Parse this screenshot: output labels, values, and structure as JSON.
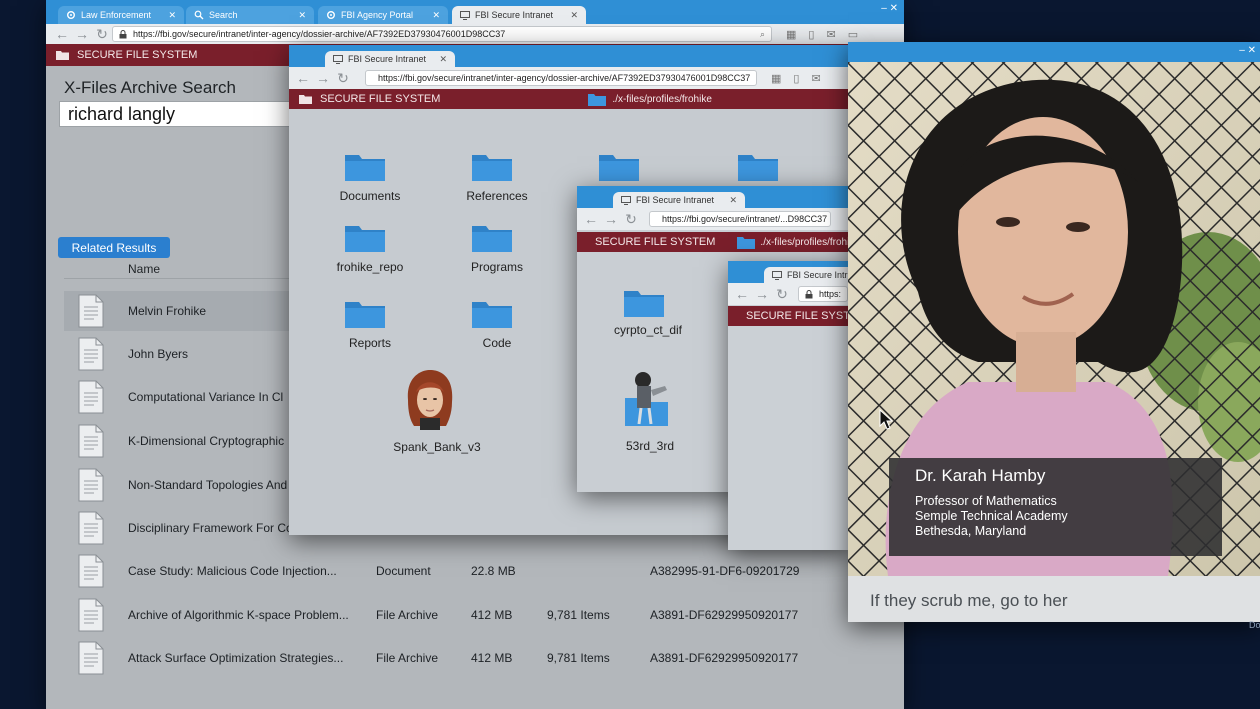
{
  "colors": {
    "tabbar": "#2f8fd5",
    "secure_bar": "#7a1f2b",
    "related_button": "#2b7fcf",
    "folder": "#3d96de",
    "desktop": "#0a1730"
  },
  "main_window": {
    "tabs": [
      {
        "label": "Law Enforcement",
        "icon": "gear-icon"
      },
      {
        "label": "Search",
        "icon": "search-icon"
      },
      {
        "label": "FBI Agency Portal",
        "icon": "gear-icon"
      },
      {
        "label": "FBI Secure Intranet",
        "icon": "monitor-icon"
      }
    ],
    "url": "https://fbi.gov/secure/intranet/inter-agency/dossier-archive/AF7392ED37930476001D98CC37",
    "secure_label": "SECURE FILE SYSTEM",
    "search_title": "X-Files Archive Search",
    "search_value": "richard langly",
    "related_results_label": "Related Results",
    "name_column": "Name",
    "files": [
      {
        "name": "Melvin Frohike",
        "type": "",
        "size": "",
        "items": "",
        "id": ""
      },
      {
        "name": "John Byers",
        "type": "",
        "size": "",
        "items": "",
        "id": ""
      },
      {
        "name": "Computational Variance In Cl",
        "type": "",
        "size": "",
        "items": "",
        "id": ""
      },
      {
        "name": "K-Dimensional Cryptographic",
        "type": "",
        "size": "",
        "items": "",
        "id": ""
      },
      {
        "name": "Non-Standard Topologies And",
        "type": "",
        "size": "",
        "items": "",
        "id": ""
      },
      {
        "name": "Disciplinary Framework For Co",
        "type": "",
        "size": "",
        "items": "",
        "id": ""
      },
      {
        "name": "Case Study: Malicious Code Injection...",
        "type": "Document",
        "size": "22.8 MB",
        "items": "",
        "id": "A382995-91-DF6-09201729"
      },
      {
        "name": "Archive of Algorithmic K-space Problem...",
        "type": "File Archive",
        "size": "412 MB",
        "items": "9,781 Items",
        "id": "A3891-DF62929950920177"
      },
      {
        "name": "Attack Surface Optimization Strategies...",
        "type": "File Archive",
        "size": "412 MB",
        "items": "9,781 Items",
        "id": "A3891-DF62929950920177"
      }
    ]
  },
  "window2": {
    "tab": "FBI Secure Intranet",
    "url": "https://fbi.gov/secure/intranet/inter-agency/dossier-archive/AF7392ED37930476001D98CC37",
    "secure_label": "SECURE FILE SYSTEM",
    "path": "./x-files/profiles/frohike",
    "folders": [
      "Documents",
      "References",
      "",
      "",
      "frohike_repo",
      "Programs",
      "Reports",
      "Code"
    ],
    "image_file": "Spank_Bank_v3"
  },
  "window3": {
    "tab": "FBI Secure Intranet",
    "url": "https://fbi.gov/secure/intranet/...D98CC37",
    "secure_label": "SECURE FILE SYSTEM",
    "path": "./x-files/profiles/frohike",
    "folder": "cyrpto_ct_dif",
    "image_file": "53rd_3rd"
  },
  "window4": {
    "tab": "FBI Secure Intr",
    "url": "https:",
    "secure_label": "SECURE FILE SYSTE"
  },
  "profile": {
    "name": "Dr. Karah Hamby",
    "title": "Professor of Mathematics",
    "institution": "Semple Technical Academy",
    "location": "Bethesda, Maryland",
    "message": "If they scrub me, go to her"
  },
  "edge_text": "Do"
}
